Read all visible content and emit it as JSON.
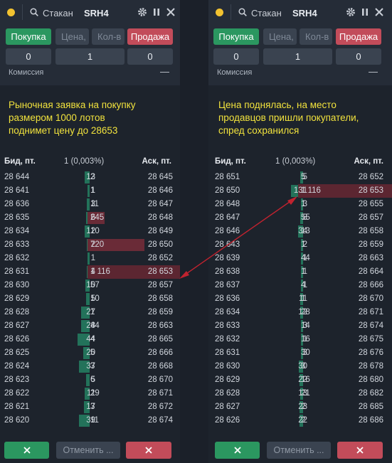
{
  "window_title": "Стакан",
  "ticker": "SRH4",
  "buy_label": "Покупка",
  "price_placeholder": "Цена,",
  "qty_placeholder": "Кол-в",
  "sell_label": "Продажа",
  "buy_value": "0",
  "qty_value": "1",
  "sell_value": "0",
  "commission_label": "Комиссия",
  "commission_value": "—",
  "col_bid": "Бид, пт.",
  "col_spread": "1 (0,003%)",
  "col_ask": "Аск, пт.",
  "cancel_label": "Отменить ...",
  "colors": {
    "buy": "#2b9760",
    "sell": "#c24c5a",
    "note": "#f2e33d",
    "arrow": "#c0232f"
  },
  "left": {
    "note_lines": [
      "Рыночная заявка на покупку",
      "размером 1000 лотов",
      "поднимет цену до 28653"
    ],
    "rows": [
      {
        "bid": "28 644",
        "bq": "13",
        "aq": "2",
        "ask": "28 645"
      },
      {
        "bid": "28 641",
        "bq": "1",
        "aq": "1",
        "ask": "28 646"
      },
      {
        "bid": "28 636",
        "bq": "3",
        "aq": "11",
        "ask": "28 647"
      },
      {
        "bid": "28 635",
        "bq": "6",
        "aq": "245",
        "ask": "28 648"
      },
      {
        "bid": "28 634",
        "bq": "12",
        "aq": "10",
        "ask": "28 649"
      },
      {
        "bid": "28 633",
        "bq": "2",
        "aq": "720",
        "ask": "28 650"
      },
      {
        "bid": "28 632",
        "bq": "1",
        "aq": "",
        "ask": "28 652"
      },
      {
        "bid": "28 631",
        "bq": "4",
        "aq": "1 116",
        "ask": "28 653"
      },
      {
        "bid": "28 630",
        "bq": "10",
        "aq": "57",
        "ask": "28 657"
      },
      {
        "bid": "28 629",
        "bq": "5",
        "aq": "10",
        "ask": "28 658"
      },
      {
        "bid": "28 628",
        "bq": "27",
        "aq": "1",
        "ask": "28 659"
      },
      {
        "bid": "28 627",
        "bq": "28",
        "aq": "44",
        "ask": "28 663"
      },
      {
        "bid": "28 626",
        "bq": "44",
        "aq": "4",
        "ask": "28 665"
      },
      {
        "bid": "28 625",
        "bq": "20",
        "aq": "5",
        "ask": "28 666"
      },
      {
        "bid": "28 624",
        "bq": "37",
        "aq": "3",
        "ask": "28 668"
      },
      {
        "bid": "28 623",
        "bq": "5",
        "aq": "6",
        "ask": "28 670"
      },
      {
        "bid": "28 622",
        "bq": "11",
        "aq": "29",
        "ask": "28 671"
      },
      {
        "bid": "28 621",
        "bq": "17",
        "aq": "3",
        "ask": "28 672"
      },
      {
        "bid": "28 620",
        "bq": "39",
        "aq": "11",
        "ask": "28 674"
      }
    ]
  },
  "right": {
    "note_lines": [
      "Цена поднялась, на место",
      "продавцов пришли покупатели,",
      "спред сохранился"
    ],
    "rows": [
      {
        "bid": "28 651",
        "bq": "5",
        "aq": "5",
        "ask": "28 652"
      },
      {
        "bid": "28 650",
        "bq": "131",
        "aq": "1 116",
        "ask": "28 653"
      },
      {
        "bid": "28 648",
        "bq": "3",
        "aq": "1",
        "ask": "28 655"
      },
      {
        "bid": "28 647",
        "bq": "8",
        "aq": "55",
        "ask": "28 657"
      },
      {
        "bid": "28 646",
        "bq": "34",
        "aq": "13",
        "ask": "28 658"
      },
      {
        "bid": "28 643",
        "bq": "2",
        "aq": "1",
        "ask": "28 659"
      },
      {
        "bid": "28 639",
        "bq": "1",
        "aq": "44",
        "ask": "28 663"
      },
      {
        "bid": "28 638",
        "bq": "1",
        "aq": "1",
        "ask": "28 664"
      },
      {
        "bid": "28 637",
        "bq": "1",
        "aq": "4",
        "ask": "28 666"
      },
      {
        "bid": "28 636",
        "bq": "11",
        "aq": "1",
        "ask": "28 670"
      },
      {
        "bid": "28 634",
        "bq": "12",
        "aq": "28",
        "ask": "28 671"
      },
      {
        "bid": "28 633",
        "bq": "3",
        "aq": "14",
        "ask": "28 674"
      },
      {
        "bid": "28 632",
        "bq": "1",
        "aq": "16",
        "ask": "28 675"
      },
      {
        "bid": "28 631",
        "bq": "3",
        "aq": "30",
        "ask": "28 676"
      },
      {
        "bid": "28 630",
        "bq": "30",
        "aq": "3",
        "ask": "28 678"
      },
      {
        "bid": "28 629",
        "bq": "22",
        "aq": "16",
        "ask": "28 680"
      },
      {
        "bid": "28 628",
        "bq": "13",
        "aq": "21",
        "ask": "28 682"
      },
      {
        "bid": "28 627",
        "bq": "23",
        "aq": "2",
        "ask": "28 685"
      },
      {
        "bid": "28 626",
        "bq": "22",
        "aq": "2",
        "ask": "28 686"
      }
    ]
  }
}
